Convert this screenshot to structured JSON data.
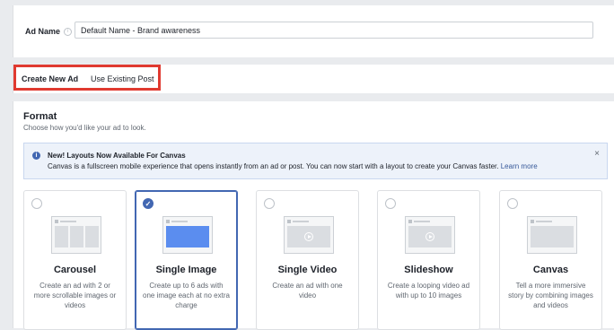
{
  "ad_name": {
    "label": "Ad Name",
    "value": "Default Name - Brand awareness"
  },
  "tabs": [
    {
      "label": "Create New Ad",
      "active": true
    },
    {
      "label": "Use Existing Post",
      "active": false
    }
  ],
  "format": {
    "title": "Format",
    "subtitle": "Choose how you'd like your ad to look.",
    "banner": {
      "title": "New! Layouts Now Available For Canvas",
      "text": "Canvas is a fullscreen mobile experience that opens instantly from an ad or post. You can now start with a layout to create your Canvas faster.",
      "link": "Learn more",
      "close": "×"
    },
    "options": [
      {
        "title": "Carousel",
        "description": "Create an ad with 2 or more scrollable images or videos",
        "selected": false,
        "icon": "carousel-thumbnail-icon"
      },
      {
        "title": "Single Image",
        "description": "Create up to 6 ads with one image each at no extra charge",
        "selected": true,
        "icon": "single-image-thumbnail-icon"
      },
      {
        "title": "Single Video",
        "description": "Create an ad with one video",
        "selected": false,
        "icon": "single-video-thumbnail-icon"
      },
      {
        "title": "Slideshow",
        "description": "Create a looping video ad with up to 10 images",
        "selected": false,
        "icon": "slideshow-thumbnail-icon"
      },
      {
        "title": "Canvas",
        "description": "Tell a more immersive story by combining images and videos",
        "selected": false,
        "icon": "canvas-thumbnail-icon"
      }
    ]
  },
  "colors": {
    "accent": "#4267b2",
    "highlight": "#e03a30",
    "banner_bg": "#edf2fa",
    "page_bg": "#e9ebee"
  }
}
